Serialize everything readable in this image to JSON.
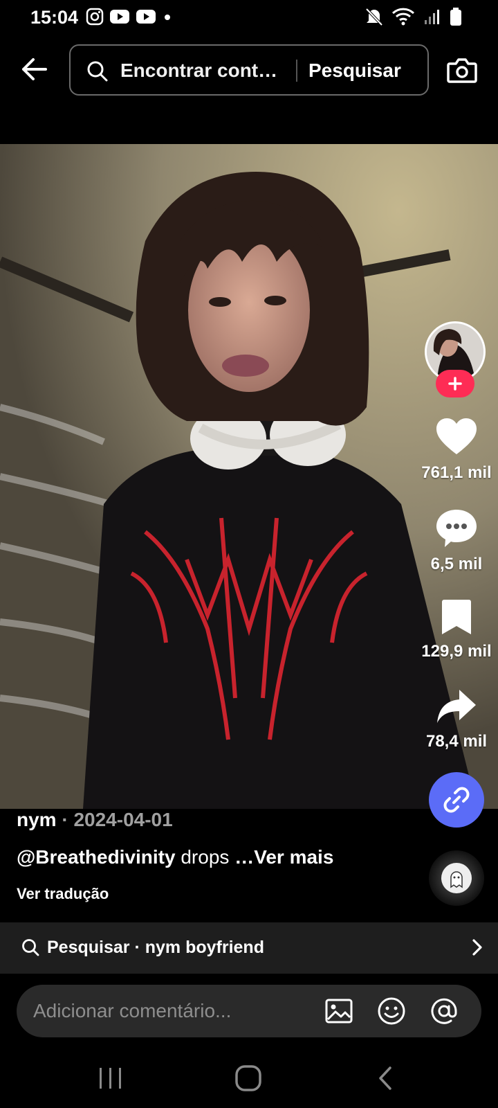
{
  "status_bar": {
    "time": "15:04",
    "left_icons": [
      "instagram-icon",
      "youtube-icon",
      "youtube-icon",
      "dot-icon"
    ],
    "right_icons": [
      "mute-icon",
      "wifi-icon",
      "signal-icon",
      "battery-icon"
    ]
  },
  "search": {
    "placeholder": "Encontrar cont…",
    "button_label": "Pesquisar"
  },
  "video": {
    "author_avatar": "avatar",
    "actions": {
      "likes": "761,1 mil",
      "comments": "6,5 mil",
      "saves": "129,9 mil",
      "shares": "78,4 mil"
    }
  },
  "caption": {
    "username": "nym",
    "separator": " · ",
    "date": "2024-04-01",
    "mention": "@Breathedivinity",
    "text": " drops ",
    "more": "…Ver mais",
    "translate": "Ver tradução"
  },
  "suggestion": {
    "label": "Pesquisar · nym boyfriend"
  },
  "comment": {
    "placeholder": "Adicionar comentário..."
  },
  "colors": {
    "follow_accent": "#fe2c55",
    "link_button": "#5b6cf7",
    "background": "#000000"
  }
}
